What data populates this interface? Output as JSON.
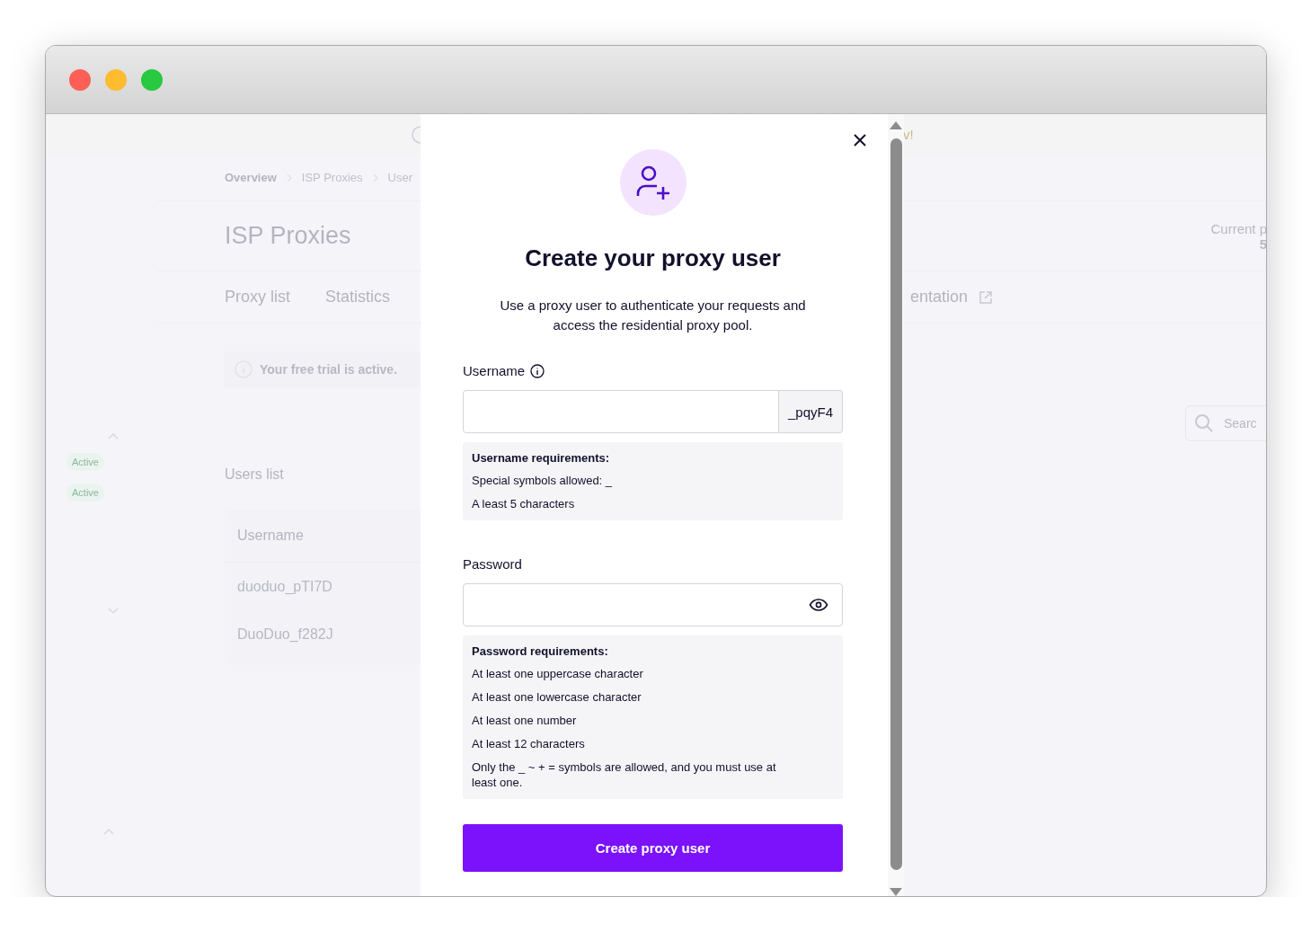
{
  "window": {
    "controls": [
      {
        "kind": "close",
        "color": "#fe5f57"
      },
      {
        "kind": "minimize",
        "color": "#febc2e"
      },
      {
        "kind": "zoom",
        "color": "#28c840"
      }
    ]
  },
  "banner": {
    "text": "v!"
  },
  "breadcrumb": [
    "Overview",
    "ISP Proxies",
    "User"
  ],
  "page": {
    "title": "ISP Proxies",
    "plan_label": "Current p",
    "plan_value": "5"
  },
  "tabs": [
    {
      "label": "Proxy list",
      "external": false
    },
    {
      "label": "Statistics",
      "external": false
    },
    {
      "label": "entation",
      "external": true
    }
  ],
  "trial_notice": "Your free trial is active.",
  "sidebar": {
    "badges": [
      "Active",
      "Active"
    ]
  },
  "search": {
    "placeholder": "Searc"
  },
  "users_list": {
    "title": "Users list",
    "columns": [
      "Username"
    ],
    "rows": [
      [
        "duoduo_pTI7D"
      ],
      [
        "DuoDuo_f282J"
      ]
    ]
  },
  "dialog": {
    "title": "Create your proxy user",
    "description": "Use a proxy user to authenticate your requests and access the residential proxy pool.",
    "username": {
      "label": "Username",
      "suffix": "_pqyF4"
    },
    "username_requirements": {
      "heading": "Username requirements:",
      "items": [
        "Special symbols allowed: _",
        "A least 5 characters"
      ]
    },
    "password": {
      "label": "Password"
    },
    "password_requirements": {
      "heading": "Password requirements:",
      "items": [
        "At least one uppercase character",
        "At least one lowercase character",
        "At least one number",
        "At least 12 characters",
        "Only the _ ~ + = symbols are allowed, and you must use at least one."
      ]
    },
    "submit": "Create proxy user"
  }
}
